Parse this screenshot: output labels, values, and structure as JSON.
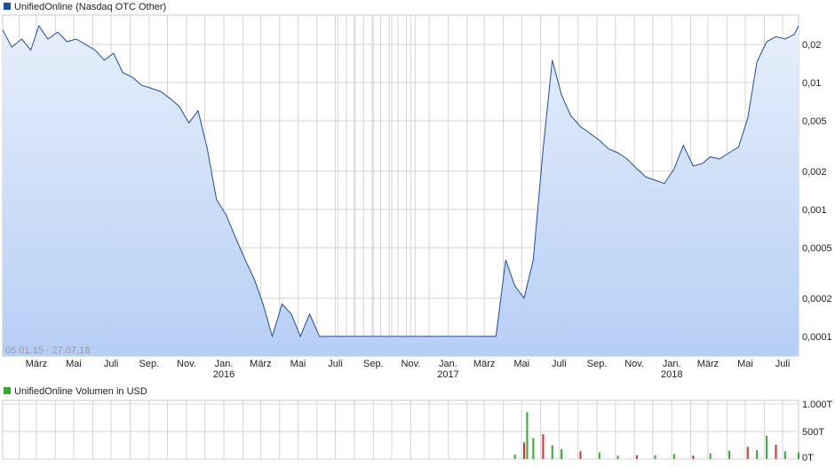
{
  "colors": {
    "price_line": "#1a4fa0",
    "price_fill_top": "#e6effb",
    "price_fill_bottom": "#b7cef5",
    "volume_up": "#33aa33",
    "volume_down": "#cc3333",
    "grid": "#d4d4d4",
    "legend_price_box": "#1a4fa0",
    "legend_volume_box": "#33aa33"
  },
  "legend": {
    "price": "UnifiedOnline (Nasdaq OTC Other)",
    "volume": "UnifiedOnline Volumen in USD"
  },
  "date_range": "05.01.15 - 27.07.18",
  "chart_data": [
    {
      "type": "line",
      "title": "UnifiedOnline (Nasdaq OTC Other)",
      "scale": "log",
      "y_ticks": [
        "0,0001",
        "0,0002",
        "0,0005",
        "0,001",
        "0,002",
        "0,005",
        "0,01",
        "0,02"
      ],
      "y_tick_values": [
        0.0001,
        0.0002,
        0.0005,
        0.001,
        0.002,
        0.005,
        0.01,
        0.02
      ],
      "x_ticks": [
        {
          "label": "März",
          "year": ""
        },
        {
          "label": "Mai",
          "year": ""
        },
        {
          "label": "Juli",
          "year": ""
        },
        {
          "label": "Sep.",
          "year": ""
        },
        {
          "label": "Nov.",
          "year": ""
        },
        {
          "label": "Jan.",
          "year": "2016"
        },
        {
          "label": "März",
          "year": ""
        },
        {
          "label": "Mai",
          "year": ""
        },
        {
          "label": "Juli",
          "year": ""
        },
        {
          "label": "Sep.",
          "year": ""
        },
        {
          "label": "Nov.",
          "year": ""
        },
        {
          "label": "Jan.",
          "year": "2017"
        },
        {
          "label": "März",
          "year": ""
        },
        {
          "label": "Mai",
          "year": ""
        },
        {
          "label": "Juli",
          "year": ""
        },
        {
          "label": "Sep.",
          "year": ""
        },
        {
          "label": "Nov.",
          "year": ""
        },
        {
          "label": "Jan.",
          "year": "2018"
        },
        {
          "label": "März",
          "year": ""
        },
        {
          "label": "Mai",
          "year": ""
        },
        {
          "label": "Juli",
          "year": ""
        }
      ],
      "series": [
        {
          "x": [
            "2015-01-05",
            "2015-01-20",
            "2015-02-05",
            "2015-02-20",
            "2015-03-05",
            "2015-03-20",
            "2015-04-05",
            "2015-04-20",
            "2015-05-05",
            "2015-05-20",
            "2015-06-05",
            "2015-06-20",
            "2015-07-05",
            "2015-07-20",
            "2015-08-05",
            "2015-08-20",
            "2015-09-05",
            "2015-09-20",
            "2015-10-05",
            "2015-10-20",
            "2015-11-05",
            "2015-11-20",
            "2015-12-05",
            "2015-12-20",
            "2016-01-05",
            "2016-01-20",
            "2016-02-05",
            "2016-02-20",
            "2016-03-05",
            "2016-03-20",
            "2016-04-05",
            "2016-04-20",
            "2016-05-05",
            "2016-05-20",
            "2016-06-05",
            "2016-06-20",
            "2016-07-05",
            "2016-07-20",
            "2016-08-05",
            "2016-08-20",
            "2016-09-05",
            "2016-10-05",
            "2016-11-05",
            "2016-12-05",
            "2017-01-05",
            "2017-01-20",
            "2017-02-05",
            "2017-02-20",
            "2017-03-05",
            "2017-03-20",
            "2017-04-05",
            "2017-04-20",
            "2017-05-05",
            "2017-05-20",
            "2017-06-05",
            "2017-06-20",
            "2017-07-05",
            "2017-07-20",
            "2017-08-05",
            "2017-08-20",
            "2017-09-05",
            "2017-09-20",
            "2017-10-05",
            "2017-10-20",
            "2017-11-05",
            "2017-11-20",
            "2017-12-05",
            "2017-12-20",
            "2018-01-05",
            "2018-01-20",
            "2018-02-05",
            "2018-02-20",
            "2018-03-05",
            "2018-03-20",
            "2018-04-05",
            "2018-04-20",
            "2018-05-05",
            "2018-05-20",
            "2018-06-05",
            "2018-06-20",
            "2018-07-05",
            "2018-07-20",
            "2018-07-27"
          ],
          "values": [
            0.026,
            0.019,
            0.022,
            0.018,
            0.028,
            0.022,
            0.025,
            0.021,
            0.022,
            0.02,
            0.018,
            0.015,
            0.017,
            0.012,
            0.011,
            0.0095,
            0.009,
            0.0085,
            0.0075,
            0.0065,
            0.0048,
            0.006,
            0.003,
            0.0012,
            0.0009,
            0.0006,
            0.0004,
            0.00028,
            0.00018,
            0.0001,
            0.00018,
            0.00015,
            0.0001,
            0.00015,
            0.0001,
            0.0001,
            0.0001,
            0.0001,
            0.0001,
            0.0001,
            0.0001,
            0.0001,
            0.0001,
            0.0001,
            0.0001,
            0.0001,
            0.0001,
            0.0001,
            0.0001,
            0.0001,
            0.0004,
            0.00025,
            0.0002,
            0.0004,
            0.003,
            0.015,
            0.008,
            0.0055,
            0.0045,
            0.004,
            0.0035,
            0.003,
            0.0028,
            0.0025,
            0.0021,
            0.0018,
            0.0017,
            0.0016,
            0.0021,
            0.0032,
            0.0022,
            0.0023,
            0.0026,
            0.0025,
            0.0028,
            0.0031,
            0.0052,
            0.0145,
            0.021,
            0.023,
            0.022,
            0.024,
            0.028
          ]
        }
      ]
    },
    {
      "type": "bar",
      "title": "UnifiedOnline Volumen in USD",
      "y_ticks": [
        "0T",
        "500T",
        "1.000T"
      ],
      "y_tick_values": [
        0,
        500,
        1000
      ],
      "ylim": [
        0,
        1000
      ],
      "series": [
        {
          "name": "Volumen",
          "x": [
            "2017-04-20",
            "2017-05-05",
            "2017-05-10",
            "2017-05-20",
            "2017-06-05",
            "2017-06-20",
            "2017-07-05",
            "2017-08-05",
            "2017-09-05",
            "2017-10-05",
            "2017-11-05",
            "2017-12-05",
            "2018-01-05",
            "2018-02-05",
            "2018-03-05",
            "2018-04-05",
            "2018-05-05",
            "2018-05-20",
            "2018-06-05",
            "2018-06-20",
            "2018-07-05",
            "2018-07-27"
          ],
          "values": [
            80,
            300,
            850,
            380,
            450,
            250,
            180,
            140,
            120,
            60,
            70,
            70,
            90,
            60,
            100,
            150,
            220,
            160,
            420,
            260,
            140,
            120
          ]
        }
      ]
    }
  ]
}
